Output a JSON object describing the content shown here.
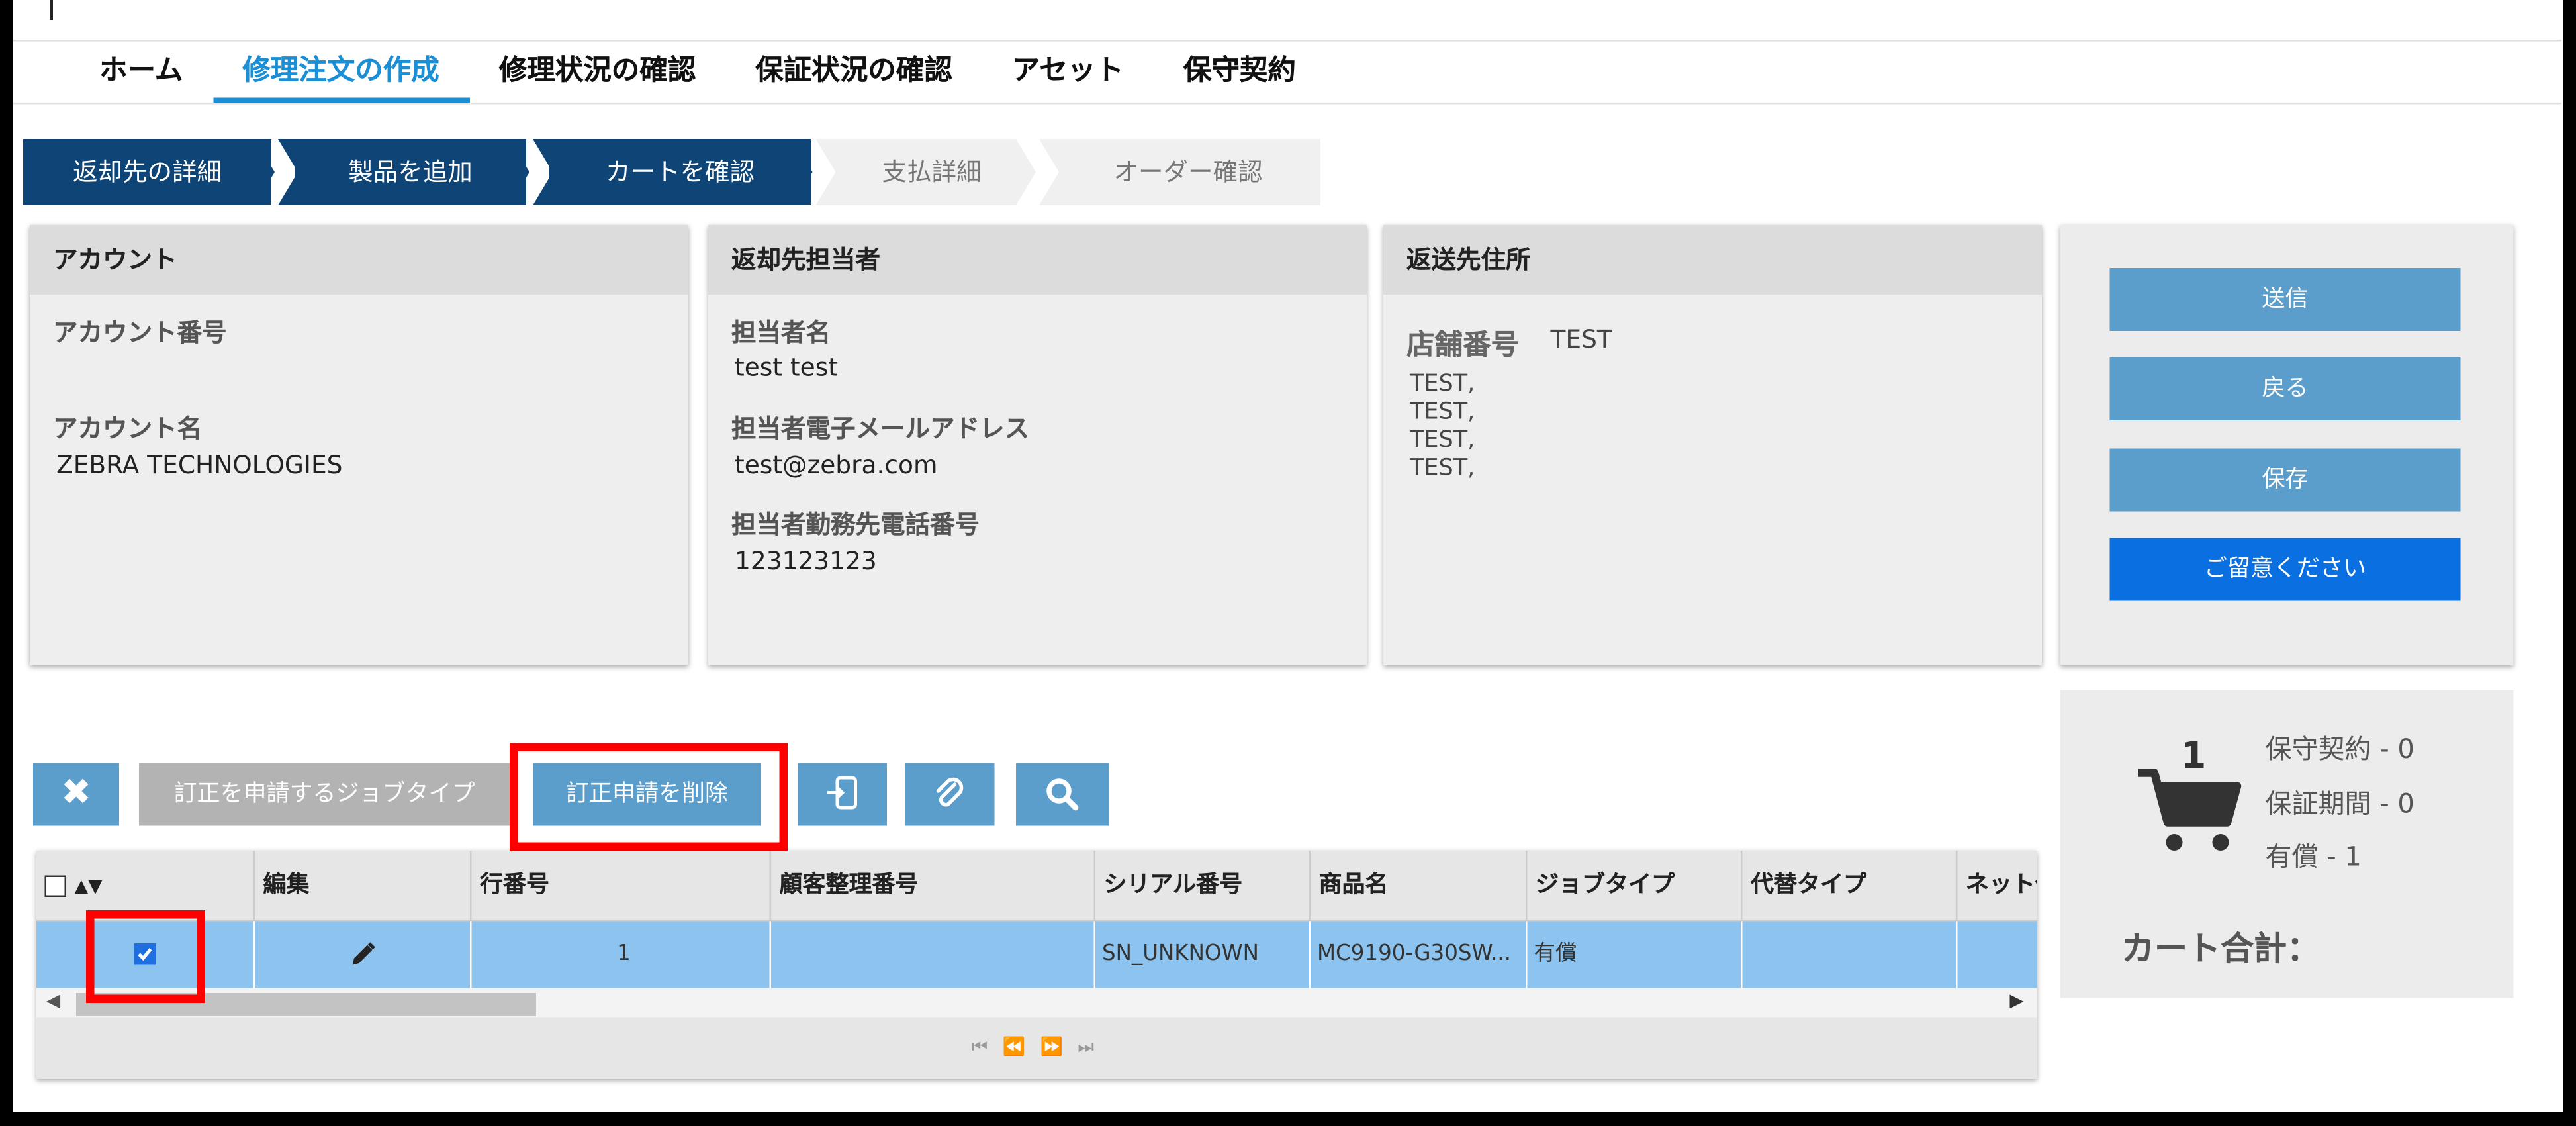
{
  "nav": {
    "items": [
      {
        "label": "ホーム",
        "active": false
      },
      {
        "label": "修理注文の作成",
        "active": true
      },
      {
        "label": "修理状況の確認",
        "active": false
      },
      {
        "label": "保証状況の確認",
        "active": false
      },
      {
        "label": "アセット",
        "active": false
      },
      {
        "label": "保守契約",
        "active": false
      }
    ]
  },
  "steps": [
    {
      "label": "返却先の詳細",
      "state": "done"
    },
    {
      "label": "製品を追加",
      "state": "done"
    },
    {
      "label": "カートを確認",
      "state": "done"
    },
    {
      "label": "支払詳細",
      "state": "todo"
    },
    {
      "label": "オーダー確認",
      "state": "todo"
    }
  ],
  "account": {
    "title": "アカウント",
    "number_label": "アカウント番号",
    "number_value": "",
    "name_label": "アカウント名",
    "name_value": "ZEBRA TECHNOLOGIES"
  },
  "contact": {
    "title": "返却先担当者",
    "name_label": "担当者名",
    "name_value": "test test",
    "email_label": "担当者電子メールアドレス",
    "email_value": "test@zebra.com",
    "phone_label": "担当者勤務先電話番号",
    "phone_value": "123123123"
  },
  "address": {
    "title": "返送先住所",
    "store_label": "店舗番号",
    "store_value": "TEST",
    "lines": [
      "TEST,",
      "TEST,",
      "TEST,",
      "TEST,"
    ]
  },
  "actions": {
    "submit": "送信",
    "back": "戻る",
    "save": "保存",
    "note": "ご留意ください"
  },
  "cart": {
    "count": "1",
    "maintenance": "保守契約 - 0",
    "warranty": "保証期間 - 0",
    "paid": "有償 - 1",
    "total_label": "カート合計："
  },
  "toolbar": {
    "delete_icon": "x-icon",
    "job_type_button": "訂正を申請するジョブタイプ",
    "remove_request_button": "訂正申請を削除"
  },
  "grid": {
    "headers": [
      "",
      "編集",
      "行番号",
      "顧客整理番号",
      "シリアル番号",
      "商品名",
      "ジョブタイプ",
      "代替タイプ",
      "ネット価"
    ],
    "rows": [
      {
        "selected": true,
        "line_no": "1",
        "customer_ref": "",
        "serial": "SN_UNKNOWN",
        "product": "MC9190-G30SW...",
        "job_type": "有償",
        "alt_type": "",
        "net_price": ""
      }
    ]
  },
  "colors": {
    "nav_active": "#1a8fd6",
    "step_done": "#0e4576",
    "button": "#5b9dcb",
    "primary_button": "#0a6fe0",
    "selected_row": "#8cc4ef",
    "highlight": "#ff0000"
  }
}
